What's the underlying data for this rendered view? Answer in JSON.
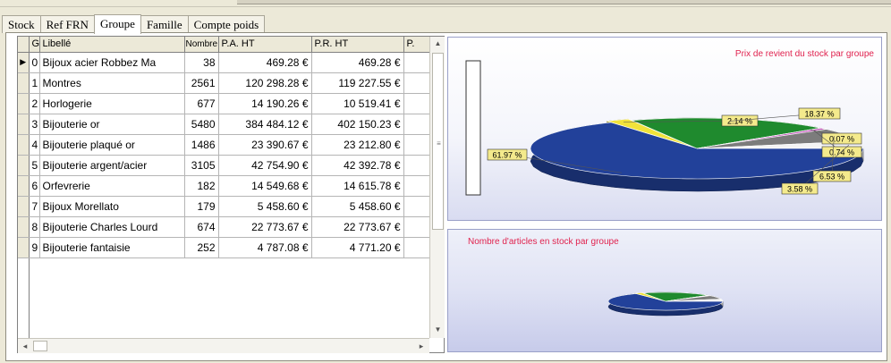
{
  "tabs": [
    {
      "label": "Stock",
      "active": false
    },
    {
      "label": "Ref FRN",
      "active": false
    },
    {
      "label": "Groupe",
      "active": true
    },
    {
      "label": "Famille",
      "active": false
    },
    {
      "label": "Compte poids",
      "active": false
    }
  ],
  "grid": {
    "columns": [
      "G",
      "Libellé",
      "Nombre",
      "P.A. HT",
      "P.R. HT",
      "P."
    ],
    "rows": [
      {
        "g": "0",
        "libelle": "Bijoux acier Robbez Ma",
        "nombre": "38",
        "pa_ht": "469.28 €",
        "pr_ht": "469.28 €",
        "current": true
      },
      {
        "g": "1",
        "libelle": "Montres",
        "nombre": "2561",
        "pa_ht": "120 298.28 €",
        "pr_ht": "119 227.55 €"
      },
      {
        "g": "2",
        "libelle": "Horlogerie",
        "nombre": "677",
        "pa_ht": "14 190.26 €",
        "pr_ht": "10 519.41 €"
      },
      {
        "g": "3",
        "libelle": "Bijouterie or",
        "nombre": "5480",
        "pa_ht": "384 484.12 €",
        "pr_ht": "402 150.23 €"
      },
      {
        "g": "4",
        "libelle": "Bijouterie plaqué or",
        "nombre": "1486",
        "pa_ht": "23 390.67 €",
        "pr_ht": "23 212.80 €"
      },
      {
        "g": "5",
        "libelle": "Bijouterie argent/acier",
        "nombre": "3105",
        "pa_ht": "42 754.90 €",
        "pr_ht": "42 392.78 €"
      },
      {
        "g": "6",
        "libelle": "Orfevrerie",
        "nombre": "182",
        "pa_ht": "14 549.68 €",
        "pr_ht": "14 615.78 €"
      },
      {
        "g": "7",
        "libelle": "Bijoux Morellato",
        "nombre": "179",
        "pa_ht": "5 458.60 €",
        "pr_ht": "5 458.60 €"
      },
      {
        "g": "8",
        "libelle": "Bijouterie Charles Lourd",
        "nombre": "674",
        "pa_ht": "22 773.67 €",
        "pr_ht": "22 773.67 €"
      },
      {
        "g": "9",
        "libelle": "Bijouterie fantaisie",
        "nombre": "252",
        "pa_ht": "4 787.08 €",
        "pr_ht": "4 771.20 €"
      }
    ]
  },
  "icons": {
    "current_row": "row-pointer-icon",
    "scroll_up": "arrow-up-icon",
    "scroll_down": "arrow-down-icon",
    "scroll_left": "arrow-left-icon",
    "scroll_right": "arrow-right-icon"
  },
  "colors": {
    "pie_main": "#22419a",
    "pie_green": "#1f8a2e",
    "pie_yellow": "#f1e33a",
    "pie_gray": "#7c7c7c",
    "pie_white": "#f4f4f4",
    "pie_magenta": "#c050b8",
    "label_bg": "#f4ea8c",
    "title": "#e0224e"
  },
  "charts": {
    "top": {
      "title": "Prix de revient du stock par groupe"
    },
    "bottom": {
      "title": "Nombre d'articles en stock par groupe"
    }
  },
  "chart_data": [
    {
      "type": "pie",
      "title": "Prix de revient du stock par groupe",
      "slices": [
        {
          "label": "61.97 %",
          "value": 61.97,
          "color": "#22419a"
        },
        {
          "label": "2.14 %",
          "value": 2.14,
          "color": "#f1e33a"
        },
        {
          "label": "18.37 %",
          "value": 18.37,
          "color": "#1f8a2e"
        },
        {
          "label": "0.07 %",
          "value": 0.07,
          "color": "#22419a"
        },
        {
          "label": "0.74 %",
          "value": 0.74,
          "color": "#c050b8"
        },
        {
          "label": "6.53 %",
          "value": 6.53,
          "color": "#7c7c7c"
        },
        {
          "label": "3.58 %",
          "value": 3.58,
          "color": "#f4f4f4"
        }
      ]
    },
    {
      "type": "pie",
      "title": "Nombre d'articles en stock par groupe",
      "slices": []
    }
  ]
}
